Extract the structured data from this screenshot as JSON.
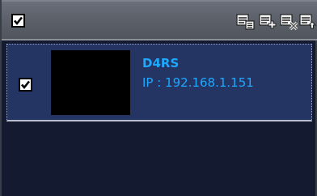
{
  "toolbar": {
    "select_all_checked": true,
    "icons": [
      "device-list-icon",
      "add-device-icon",
      "remove-device-icon",
      "export-device-icon"
    ]
  },
  "devices": [
    {
      "name": "D4RS",
      "ip": "IP : 192.168.1.151",
      "checked": true
    }
  ],
  "colors": {
    "accent_text": "#1ea8ff",
    "row_selected_bg": "#243463",
    "panel_bg": "#141a30",
    "toolbar_bg": "#5b6069"
  }
}
